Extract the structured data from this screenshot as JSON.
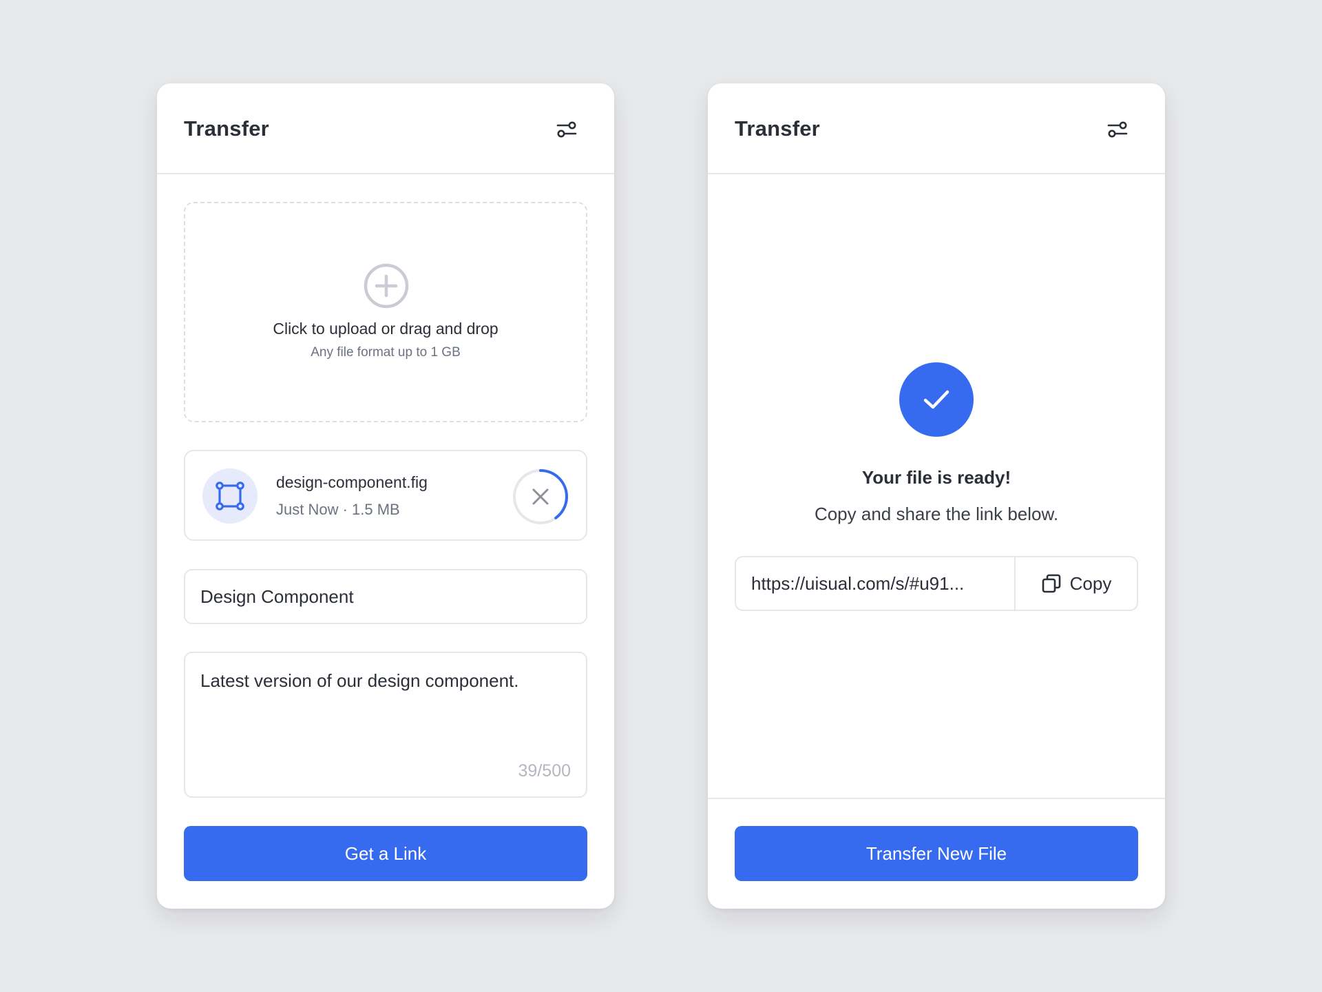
{
  "colors": {
    "background": "#e8e9eb",
    "accent": "#376bef",
    "card": "#ffffff",
    "border": "#e5e7eb",
    "muted_text": "#6b7280",
    "placeholder_text": "#b3b7bf"
  },
  "upload_panel": {
    "title": "Transfer",
    "settings_icon": "sliders-icon",
    "dropzone": {
      "icon": "plus-circle-icon",
      "title": "Click to upload or drag and drop",
      "subtitle": "Any file format up to 1 GB"
    },
    "file": {
      "icon": "frame-icon",
      "name": "design-component.fig",
      "meta": "Just Now · 1.5 MB",
      "upload_progress_percent": 40,
      "cancel_icon": "close-icon"
    },
    "title_field": {
      "value": "Design Component"
    },
    "message_field": {
      "value": "Latest version of our design component.",
      "char_count": "39/500"
    },
    "submit_label": "Get a Link"
  },
  "success_panel": {
    "title": "Transfer",
    "settings_icon": "sliders-icon",
    "status_icon": "check-icon",
    "status_title": "Your file is ready!",
    "status_subtitle": "Copy and share the link below.",
    "link": "https://uisual.com/s/#u91...",
    "copy_icon": "copy-icon",
    "copy_label": "Copy",
    "new_transfer_label": "Transfer New File"
  }
}
